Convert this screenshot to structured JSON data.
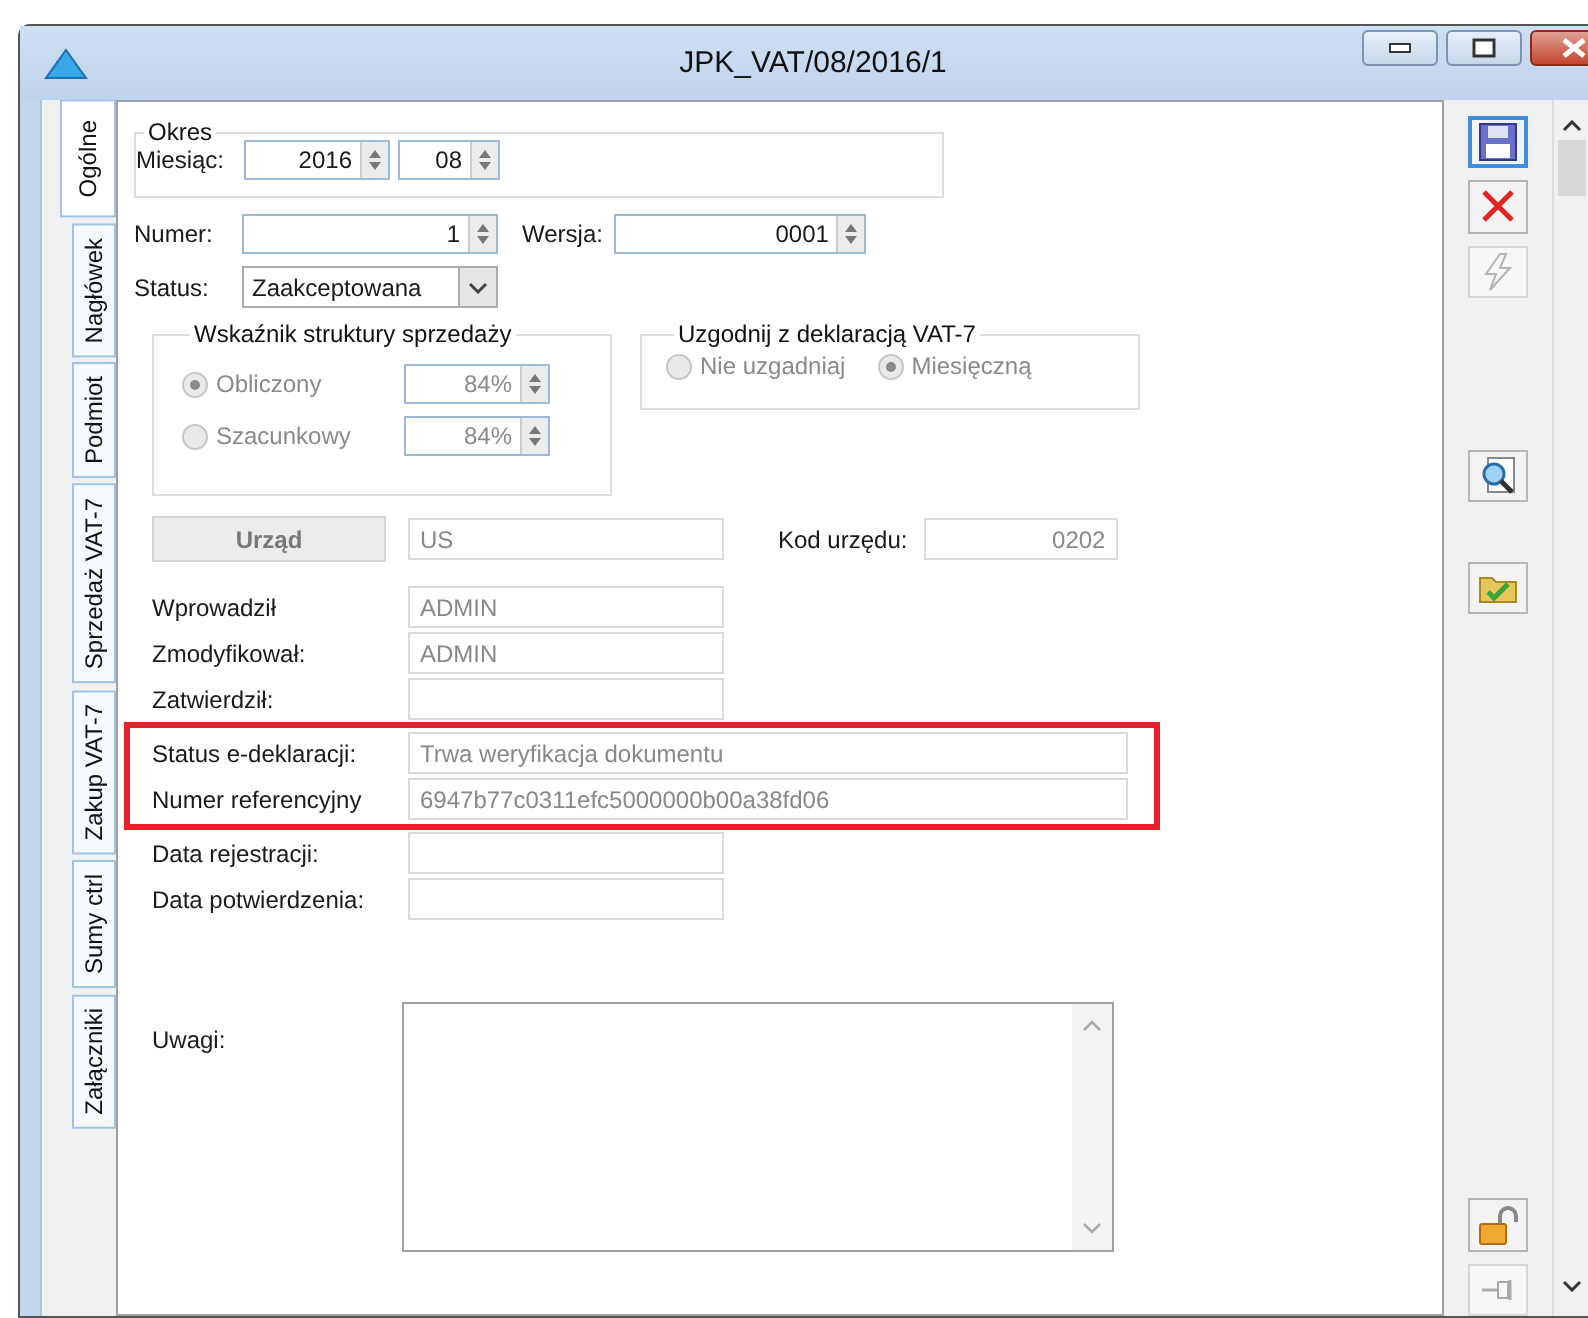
{
  "window": {
    "title": "JPK_VAT/08/2016/1"
  },
  "side_tabs": [
    {
      "label": "Ogólne",
      "selected": true
    },
    {
      "label": "Nagłówek",
      "selected": false
    },
    {
      "label": "Podmiot",
      "selected": false
    },
    {
      "label": "Sprzedaż VAT-7",
      "selected": false
    },
    {
      "label": "Zakup VAT-7",
      "selected": false
    },
    {
      "label": "Sumy ctrl",
      "selected": false
    },
    {
      "label": "Załączniki",
      "selected": false
    }
  ],
  "okres": {
    "legend": "Okres",
    "label": "Miesiąc:",
    "year": "2016",
    "month": "08"
  },
  "numer": {
    "label": "Numer:",
    "value": "1"
  },
  "wersja": {
    "label": "Wersja:",
    "value": "0001"
  },
  "status": {
    "label": "Status:",
    "value": "Zaakceptowana"
  },
  "wskaznik": {
    "legend": "Wskaźnik struktury sprzedaży",
    "disabled": true,
    "options": [
      {
        "label": "Obliczony",
        "selected": true,
        "value": "84%"
      },
      {
        "label": "Szacunkowy",
        "selected": false,
        "value": "84%"
      }
    ]
  },
  "uzgodnij": {
    "legend": "Uzgodnij z deklaracją VAT-7",
    "disabled": true,
    "options": [
      {
        "label": "Nie uzgadniaj",
        "selected": false
      },
      {
        "label": "Miesięczną",
        "selected": true
      }
    ]
  },
  "urzad": {
    "button": "Urząd",
    "value": "US",
    "code_label": "Kod urzędu:",
    "code": "0202"
  },
  "info_rows": [
    {
      "label": "Wprowadził",
      "value": "ADMIN"
    },
    {
      "label": "Zmodyfikował:",
      "value": "ADMIN"
    },
    {
      "label": "Zatwierdził:",
      "value": ""
    }
  ],
  "highlighted_rows": [
    {
      "label": "Status e-deklaracji:",
      "value": "Trwa weryfikacja dokumentu"
    },
    {
      "label": "Numer referencyjny",
      "value": "6947b77c0311efc5000000b00a38fd06"
    }
  ],
  "date_rows": [
    {
      "label": "Data rejestracji:",
      "value": ""
    },
    {
      "label": "Data potwierdzenia:",
      "value": ""
    }
  ],
  "notes": {
    "label": "Uwagi:"
  },
  "toolbar": [
    {
      "kind": "save",
      "disabled": false
    },
    {
      "kind": "delete",
      "disabled": false
    },
    {
      "kind": "lightning",
      "disabled": true
    },
    {
      "kind": "search",
      "disabled": false
    },
    {
      "kind": "folder",
      "disabled": false
    },
    {
      "kind": "lock",
      "disabled": false
    },
    {
      "kind": "pin",
      "disabled": true
    }
  ]
}
